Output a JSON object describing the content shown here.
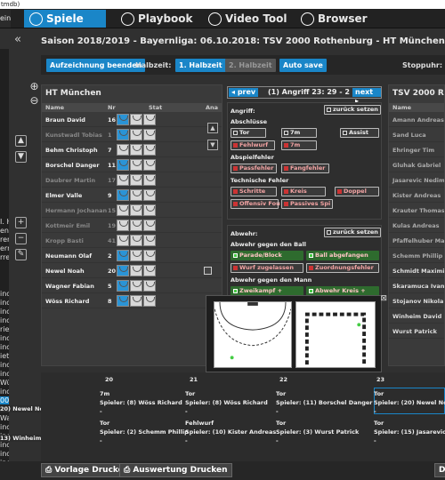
{
  "window": {
    "title": "tmdb)"
  },
  "topnav": {
    "left_tab": "ein",
    "tabs": [
      {
        "label": "Spiele",
        "icon": "soccer-ball-icon",
        "active": true
      },
      {
        "label": "Playbook",
        "icon": "playbook-icon",
        "active": false
      },
      {
        "label": "Video Tool",
        "icon": "play-icon",
        "active": false
      },
      {
        "label": "Browser",
        "icon": "globe-icon",
        "active": false
      }
    ]
  },
  "main": {
    "title": "Saison 2018/2019 - Bayernliga:  06.10.2018: TSV 2000 Rothenburg - HT München"
  },
  "controls": {
    "record": "Aufzeichnung beenden",
    "halftime_label": "Halbzeit:",
    "first_half": "1. Halbzeit",
    "second_half": "2. Halbzeit",
    "autosave": "Auto save",
    "stopwatch": "Stoppuhr:"
  },
  "left_strip": [
    "I. H",
    "en",
    "ren",
    "ern",
    "rre",
    "inc",
    "inc",
    "inc",
    "inc",
    "rie",
    "inc",
    "inc",
    "iet",
    "inc",
    "inc",
    "Wü",
    "inc",
    "000",
    "inc",
    "Wal",
    "inc",
    "inc",
    "inc",
    "inc",
    "inc",
    "au"
  ],
  "home": {
    "title": "HT München",
    "headers": [
      "Name",
      "Nr",
      "Stat",
      "Ana"
    ],
    "players": [
      {
        "name": "Braun David",
        "nr": "16",
        "dim": false
      },
      {
        "name": "Kunstwadl Tobias",
        "nr": "1",
        "dim": true
      },
      {
        "name": "Behm Christoph",
        "nr": "7",
        "dim": false
      },
      {
        "name": "Borschel Danger",
        "nr": "11",
        "dim": false
      },
      {
        "name": "Daubrer Martin",
        "nr": "17",
        "dim": true
      },
      {
        "name": "Elmer Valle",
        "nr": "9",
        "dim": false
      },
      {
        "name": "Hermann Jochanan",
        "nr": "15",
        "dim": true
      },
      {
        "name": "Kottmeir Emil",
        "nr": "19",
        "dim": true
      },
      {
        "name": "Kropp Basti",
        "nr": "41",
        "dim": true
      },
      {
        "name": "Neumann Olaf",
        "nr": "2",
        "dim": false
      },
      {
        "name": "Newel Noah",
        "nr": "20",
        "dim": false
      },
      {
        "name": "Wagner Fabian",
        "nr": "5",
        "dim": false
      },
      {
        "name": "Wöss Richard",
        "nr": "8",
        "dim": false
      }
    ]
  },
  "away": {
    "title": "TSV 2000 Roth",
    "header": "Name",
    "players": [
      "Amann Andreas",
      "Sand Luca",
      "Ehringer Tim",
      "Gluhak Gabriel",
      "Jasarevic Nedim",
      "Kister Andreas",
      "Krauter Thomas",
      "Kulas Andreas",
      "Pfaffelhuber Max",
      "Schemm Phillip",
      "Schmidt Maximilia",
      "Skaramuca Ivan",
      "Stojanov Nikola",
      "Winheim David",
      "Wurst Patrick"
    ]
  },
  "attack": {
    "prev": "prev",
    "label": "(1) Angriff 23:  29  -  2",
    "next": "next",
    "angriff": "Angriff:",
    "reset": "zurück setzen",
    "abschluesse": "Abschlüsse",
    "tor": "Tor",
    "sieben": "7m",
    "assist": "Assist",
    "fehlwurf": "Fehlwurf",
    "sieben_red": "7m",
    "abspielfehler": "Abspielfehler",
    "passfehler": "Passfehler",
    "fangfehler": "Fangfehler",
    "technische": "Technische Fehler",
    "schritte": "Schritte",
    "kreis": "Kreis",
    "doppel": "Doppel",
    "offensiv": "Offensiv Fou",
    "passives": "Passives Spi"
  },
  "defense": {
    "abwehr": "Abwehr:",
    "reset": "zurück setzen",
    "gegen_ball": "Abwehr gegen den Ball",
    "parade": "Parade/Block",
    "ball_abgefangen": "Ball abgefangen",
    "wurf_zugelassen": "Wurf zugelassen",
    "zuordnung": "Zuordnungsfehler",
    "gegen_mann": "Abwehr gegen den Mann",
    "zweikampf": "Zweikampf +",
    "abwehr_kreis": "Abwehr Kreis +"
  },
  "timeline": {
    "cols": [
      "20",
      "21",
      "22",
      "23"
    ],
    "row1_left": "20) Newel Noah",
    "row2_left": "13) Winheim David",
    "cells": [
      [
        "7m",
        "Tor",
        "Tor",
        "Tor"
      ],
      [
        "Spieler: (8) Wöss Richard",
        "Spieler: (8) Wöss Richard",
        "Spieler: (11) Borschel Danger",
        "Spieler: (20) Newel Noah"
      ],
      [
        "Tor",
        "Fehlwurf",
        "Tor",
        "Tor"
      ],
      [
        "Spieler: (2) Schemm Phillip",
        "Spieler: (10) Kister Andreas",
        "Spieler: (3) Wurst Patrick",
        "Spieler: (15) Jasarevic N"
      ]
    ]
  },
  "footer": {
    "print_template": "Vorlage Drucken",
    "print_eval": "Auswertung Drucken",
    "right_btn": "D"
  },
  "colors": {
    "accent": "#1a86c8",
    "bg": "#303030"
  }
}
